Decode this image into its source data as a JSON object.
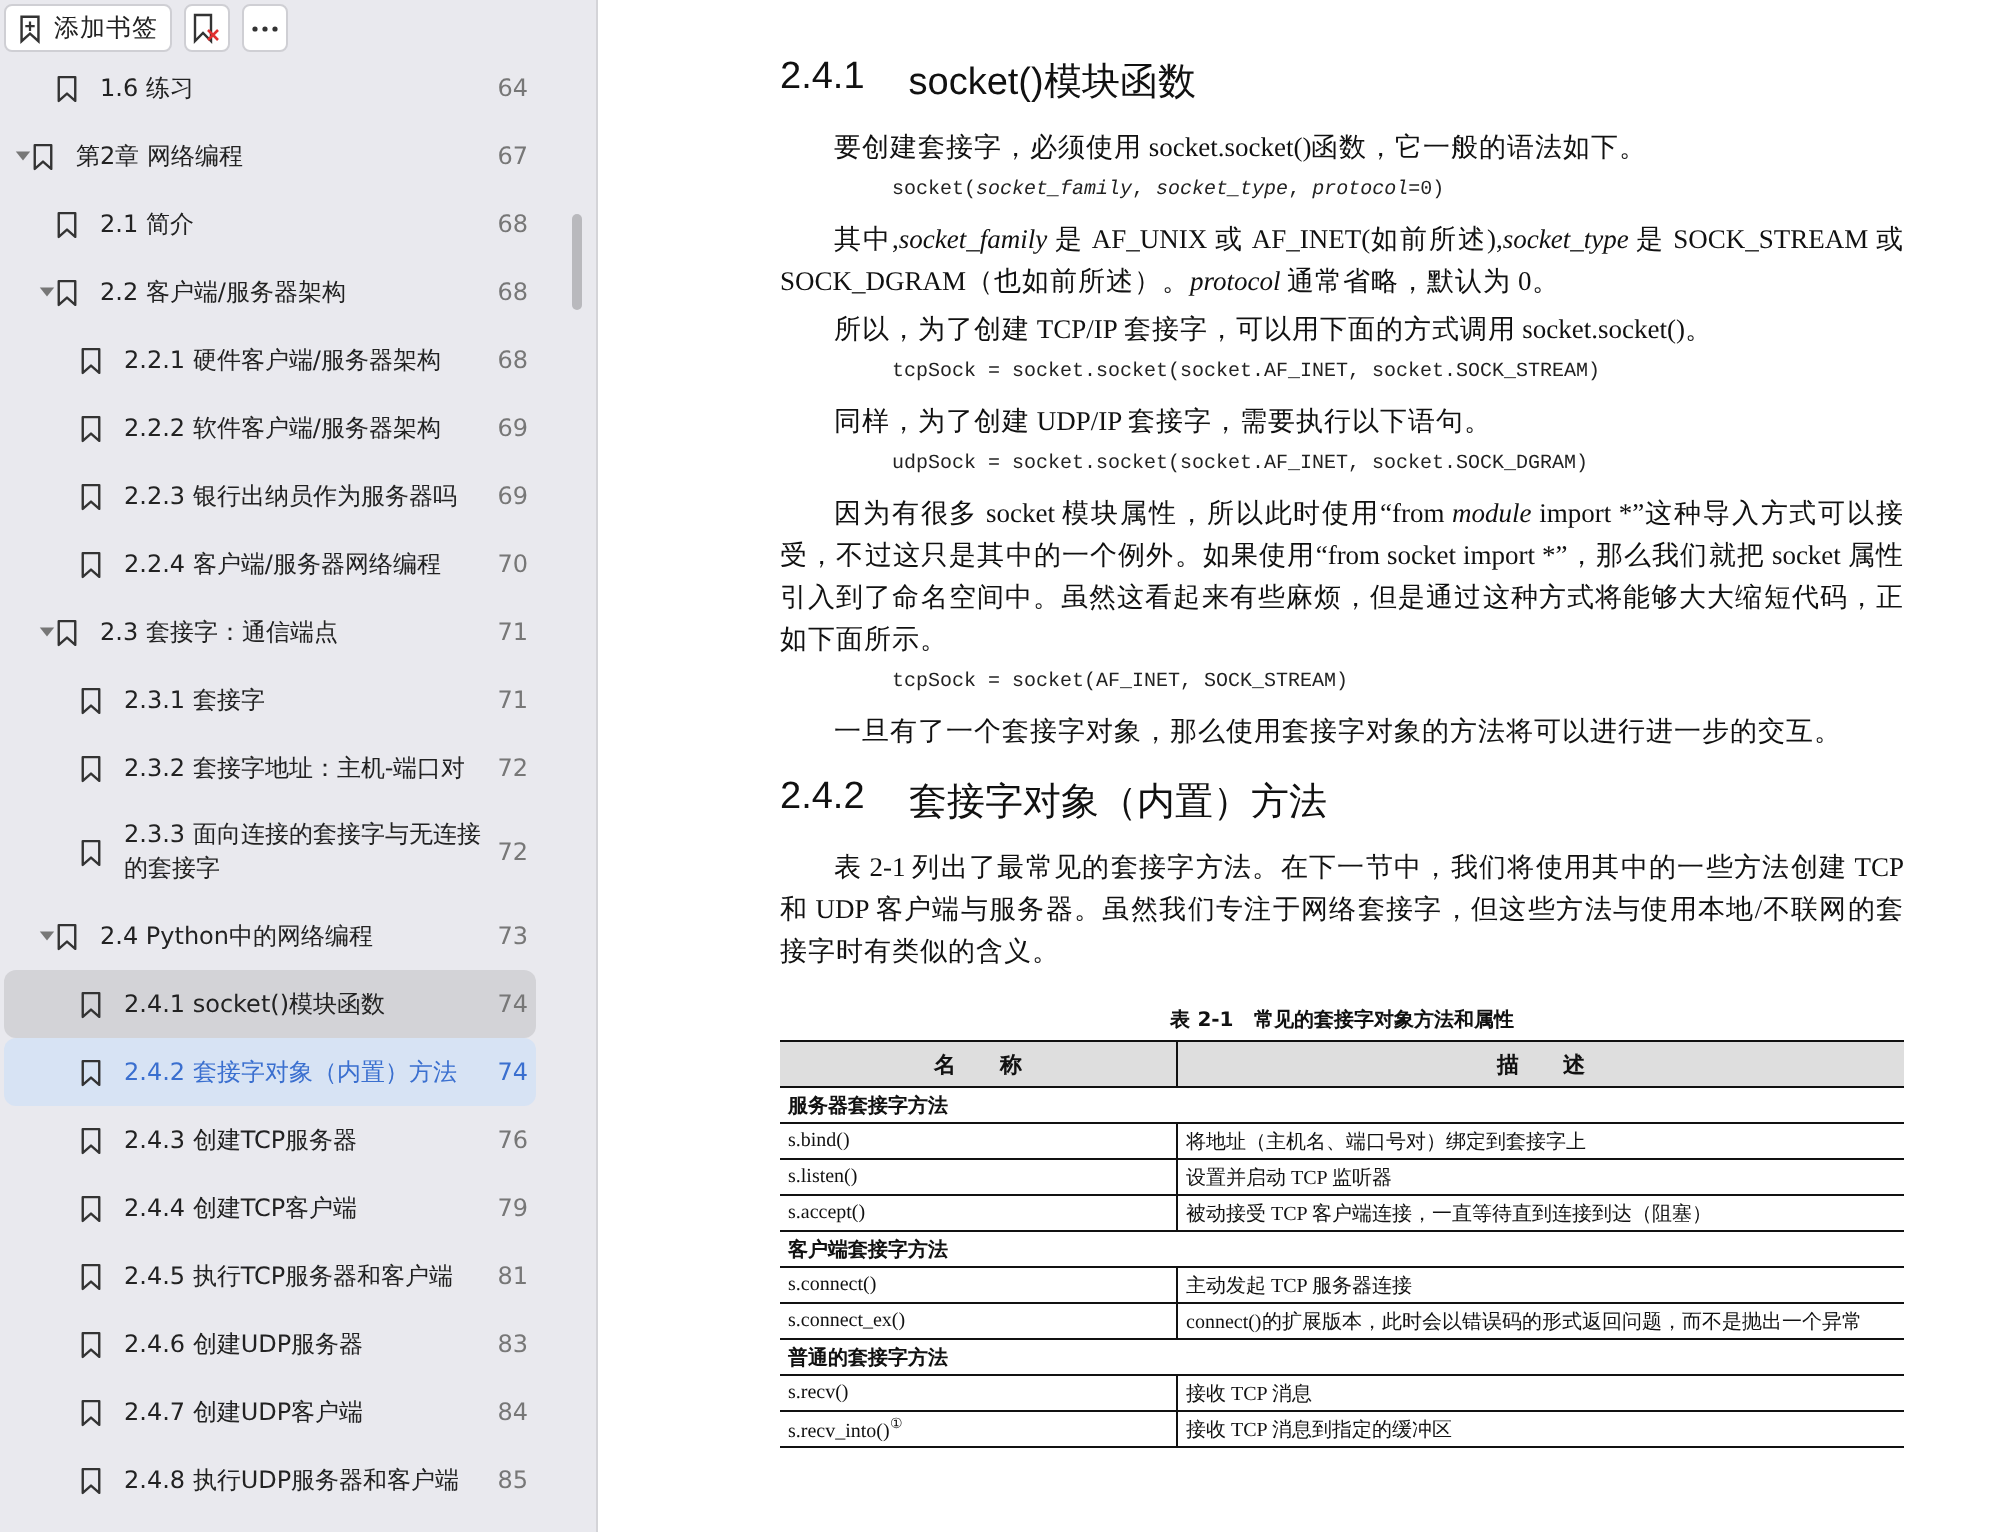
{
  "toolbar": {
    "add_bookmark": "添加书签"
  },
  "outline": [
    {
      "children": [
        {
          "label": "1.6 练习",
          "page": "64",
          "selected": false,
          "hovered": false
        }
      ]
    },
    {
      "label": "第2章 网络编程",
      "page": "67",
      "selected": false,
      "hovered": false,
      "expanded": true,
      "children": [
        {
          "label": "2.1 简介",
          "page": "68",
          "selected": false,
          "hovered": false
        },
        {
          "label": "2.2 客户端/服务器架构",
          "page": "68",
          "selected": false,
          "hovered": false,
          "expanded": true,
          "children": [
            {
              "label": "2.2.1 硬件客户端/服务器架构",
              "page": "68",
              "selected": false,
              "hovered": false
            },
            {
              "label": "2.2.2 软件客户端/服务器架构",
              "page": "69",
              "selected": false,
              "hovered": false
            },
            {
              "label": "2.2.3 银行出纳员作为服务器吗",
              "page": "69",
              "selected": false,
              "hovered": false
            },
            {
              "label": "2.2.4 客户端/服务器网络编程",
              "page": "70",
              "selected": false,
              "hovered": false
            }
          ]
        },
        {
          "label": "2.3 套接字：通信端点",
          "page": "71",
          "selected": false,
          "hovered": false,
          "expanded": true,
          "children": [
            {
              "label": "2.3.1 套接字",
              "page": "71",
              "selected": false,
              "hovered": false
            },
            {
              "label": "2.3.2 套接字地址：主机-端口对",
              "page": "72",
              "selected": false,
              "hovered": false
            },
            {
              "label": "2.3.3 面向连接的套接字与无连接的套接字",
              "page": "72",
              "selected": false,
              "hovered": false
            }
          ]
        },
        {
          "label": "2.4 Python中的网络编程",
          "page": "73",
          "selected": false,
          "hovered": false,
          "expanded": true,
          "children": [
            {
              "label": "2.4.1 socket()模块函数",
              "page": "74",
              "selected": false,
              "hovered": true
            },
            {
              "label": "2.4.2 套接字对象（内置）方法",
              "page": "74",
              "selected": true,
              "hovered": false
            },
            {
              "label": "2.4.3 创建TCP服务器",
              "page": "76",
              "selected": false,
              "hovered": false
            },
            {
              "label": "2.4.4 创建TCP客户端",
              "page": "79",
              "selected": false,
              "hovered": false
            },
            {
              "label": "2.4.5 执行TCP服务器和客户端",
              "page": "81",
              "selected": false,
              "hovered": false
            },
            {
              "label": "2.4.6 创建UDP服务器",
              "page": "83",
              "selected": false,
              "hovered": false
            },
            {
              "label": "2.4.7 创建UDP客户端",
              "page": "84",
              "selected": false,
              "hovered": false
            },
            {
              "label": "2.4.8 执行UDP服务器和客户端",
              "page": "85",
              "selected": false,
              "hovered": false
            }
          ]
        }
      ]
    }
  ],
  "document": [
    {
      "kind": "heading",
      "number": "2.4.1",
      "text": "socket()模块函数"
    },
    {
      "kind": "paragraph",
      "text": "要创建套接字，必须使用 socket.socket()函数，它一般的语法如下。"
    },
    {
      "kind": "code",
      "text": "socket(*socket_family*, *socket_type*, *protocol*=0)"
    },
    {
      "kind": "paragraph",
      "text": "其中,*socket_family* 是 AF_UNIX 或 AF_INET(如前所述),*socket_type* 是 SOCK_STREAM 或 SOCK_DGRAM（也如前所述）。*protocol* 通常省略，默认为 0。"
    },
    {
      "kind": "paragraph",
      "text": "所以，为了创建 TCP/IP 套接字，可以用下面的方式调用 socket.socket()。"
    },
    {
      "kind": "code",
      "text": "tcpSock = socket.socket(socket.AF_INET, socket.SOCK_STREAM)"
    },
    {
      "kind": "paragraph",
      "text": "同样，为了创建 UDP/IP 套接字，需要执行以下语句。"
    },
    {
      "kind": "code",
      "text": "udpSock = socket.socket(socket.AF_INET, socket.SOCK_DGRAM)"
    },
    {
      "kind": "paragraph",
      "text": "因为有很多 socket 模块属性，所以此时使用“from *module* import *”这种导入方式可以接受，不过这只是其中的一个例外。如果使用“from socket import *”，那么我们就把 socket 属性引入到了命名空间中。虽然这看起来有些麻烦，但是通过这种方式将能够大大缩短代码，正如下面所示。"
    },
    {
      "kind": "code",
      "text": "tcpSock = socket(AF_INET, SOCK_STREAM)"
    },
    {
      "kind": "paragraph",
      "text": "一旦有了一个套接字对象，那么使用套接字对象的方法将可以进行进一步的交互。"
    },
    {
      "kind": "heading",
      "number": "2.4.2",
      "text": "套接字对象（内置）方法"
    },
    {
      "kind": "paragraph",
      "text": "表 2-1 列出了最常见的套接字方法。在下一节中，我们将使用其中的一些方法创建 TCP 和 UDP 客户端与服务器。虽然我们专注于网络套接字，但这些方法与使用本地/不联网的套接字时有类似的含义。"
    },
    {
      "kind": "table",
      "caption": "表 2-1　常见的套接字对象方法和属性",
      "columns": [
        "名　　称",
        "描　　述"
      ],
      "rows": [
        {
          "kind": "group",
          "cells": [
            {
              "text": "服务器套接字方法",
              "colspan": 2
            }
          ]
        },
        {
          "kind": "row",
          "cells": [
            "s.bind()",
            "将地址（主机名、端口号对）绑定到套接字上"
          ]
        },
        {
          "kind": "row",
          "cells": [
            "s.listen()",
            "设置并启动 TCP 监听器"
          ]
        },
        {
          "kind": "row",
          "cells": [
            "s.accept()",
            "被动接受 TCP 客户端连接，一直等待直到连接到达（阻塞）"
          ]
        },
        {
          "kind": "group",
          "cells": [
            {
              "text": "客户端套接字方法",
              "colspan": 2
            }
          ]
        },
        {
          "kind": "row",
          "cells": [
            "s.connect()",
            "主动发起 TCP 服务器连接"
          ]
        },
        {
          "kind": "row",
          "cells": [
            "s.connect_ex()",
            "connect()的扩展版本，此时会以错误码的形式返回问题，而不是抛出一个异常"
          ]
        },
        {
          "kind": "group",
          "cells": [
            {
              "text": "普通的套接字方法",
              "colspan": 2
            }
          ]
        },
        {
          "kind": "row",
          "cells": [
            "s.recv()",
            "接收 TCP 消息"
          ]
        },
        {
          "kind": "row",
          "cells": [
            "s.recv_into()$^{①}$",
            "接收 TCP 消息到指定的缓冲区"
          ]
        }
      ]
    }
  ]
}
